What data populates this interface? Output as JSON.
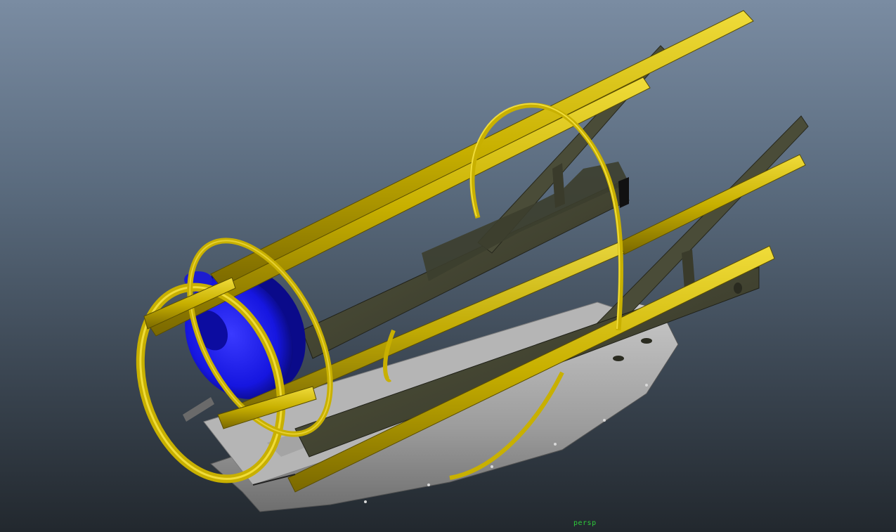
{
  "viewport": {
    "camera_label": "persp",
    "label_color": "#2ecc3a"
  },
  "colors": {
    "background_top": "#7a8ca2",
    "background_bottom": "#22282e",
    "frame_yellow": "#c8b000",
    "frame_yellow_highlight": "#f0dc3a",
    "frame_yellow_shadow": "#7a6800",
    "structure_olive": "#4a4c38",
    "structure_olive_dark": "#2f3024",
    "tray_gray": "#9a9a9a",
    "tray_gray_light": "#c2c2c2",
    "disc_blue": "#1616e0",
    "disc_blue_dark": "#0a0a8a"
  }
}
